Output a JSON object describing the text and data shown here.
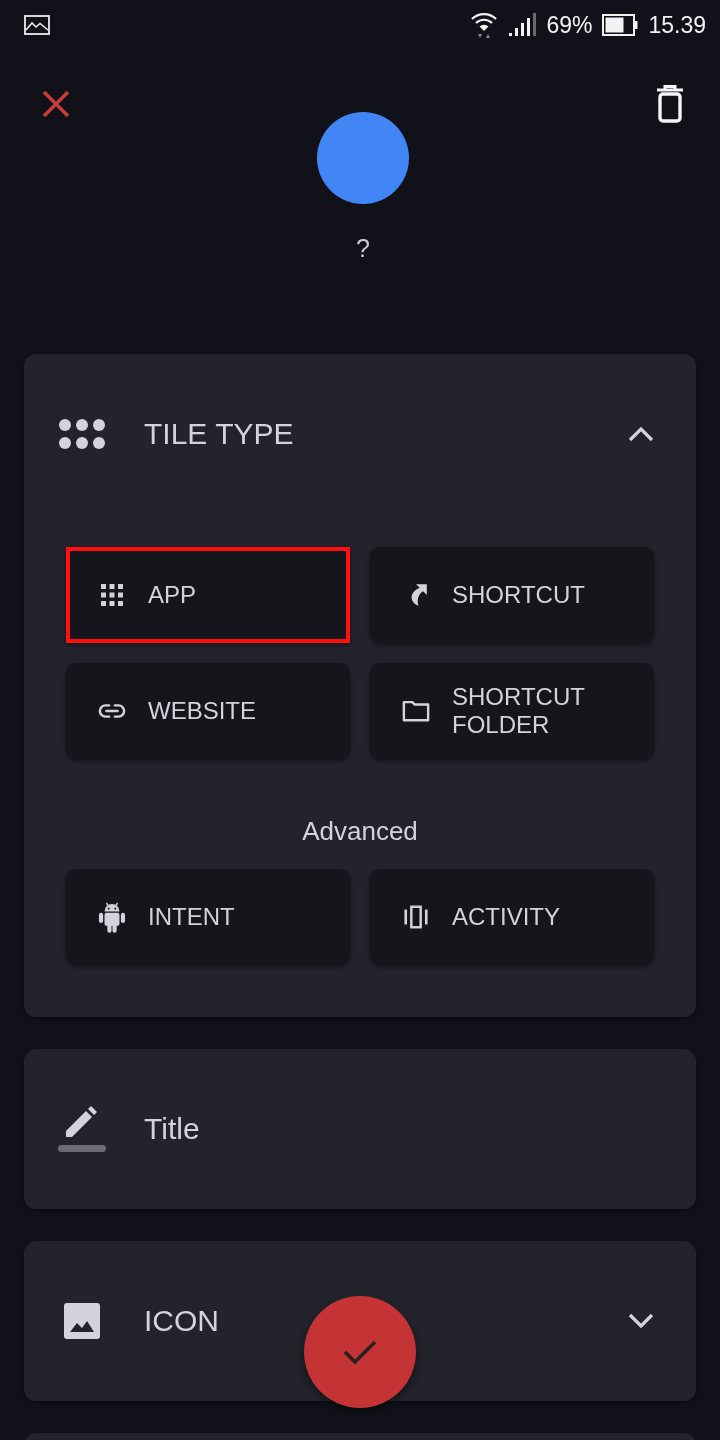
{
  "status_bar": {
    "battery": "69%",
    "time": "15.39"
  },
  "preview": {
    "label": "?"
  },
  "sections": [
    {
      "kind": "tile_type",
      "title": "TILE TYPE",
      "expanded": true,
      "options": [
        {
          "kind": "app",
          "label": "APP",
          "selected": true
        },
        {
          "kind": "shortcut",
          "label": "SHORTCUT",
          "selected": false
        },
        {
          "kind": "website",
          "label": "WEBSITE",
          "selected": false
        },
        {
          "kind": "shortcut_folder",
          "label": "SHORTCUT FOLDER",
          "selected": false
        }
      ],
      "advanced": {
        "label": "Advanced",
        "options": [
          {
            "kind": "intent",
            "label": "INTENT",
            "selected": false
          },
          {
            "kind": "activity",
            "label": "ACTIVITY",
            "selected": false
          }
        ]
      }
    },
    {
      "kind": "title",
      "placeholder": "Title"
    },
    {
      "kind": "icon",
      "title": "ICON",
      "expanded": false
    }
  ]
}
